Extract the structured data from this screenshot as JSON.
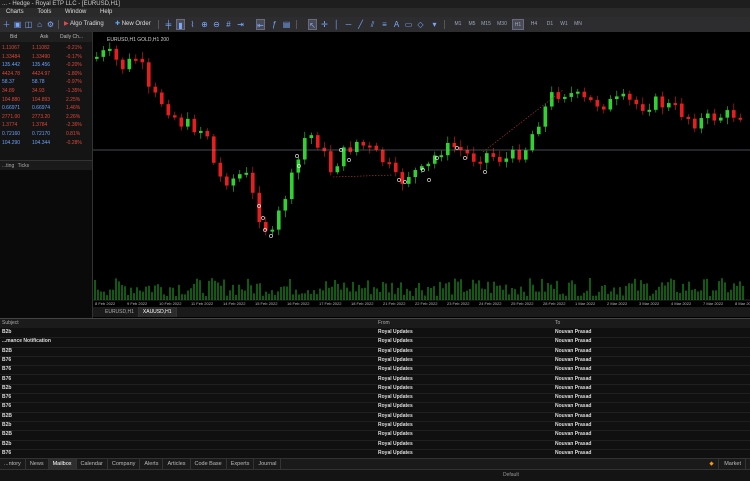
{
  "window": {
    "title": "... - Hedge - Royal ETP LLC - [EURUSD,H1]"
  },
  "menu": [
    "Charts",
    "Tools",
    "Window",
    "Help"
  ],
  "toolbar": {
    "algo_trading": "Algo Trading",
    "new_order": "New Order",
    "timeframes": [
      "M1",
      "M5",
      "M15",
      "M30",
      "H1",
      "H4",
      "D1",
      "W1",
      "MN"
    ],
    "active_timeframe": "H1"
  },
  "market_watch": {
    "headers": [
      "Bid",
      "Ask",
      "Daily Ch..."
    ],
    "rows": [
      {
        "bid": "1.11067",
        "ask": "1.11082",
        "change": "-0.21%",
        "color": "#e0473a"
      },
      {
        "bid": "1.33484",
        "ask": "1.33490",
        "change": "-0.17%",
        "color": "#e0473a"
      },
      {
        "bid": "135.442",
        "ask": "135.456",
        "change": "-0.20%",
        "color": "#6aa2ff"
      },
      {
        "bid": "4424.78",
        "ask": "4424.97",
        "change": "-1.80%",
        "color": "#e0473a"
      },
      {
        "bid": "58.37",
        "ask": "58.78",
        "change": "-0.97%",
        "color": "#6aa2ff"
      },
      {
        "bid": "34.89",
        "ask": "34.93",
        "change": "-1.35%",
        "color": "#e0473a"
      },
      {
        "bid": "104.880",
        "ask": "104.893",
        "change": "2.25%",
        "color": "#e0473a"
      },
      {
        "bid": "0.66971",
        "ask": "0.66974",
        "change": "1.46%",
        "color": "#6aa2ff"
      },
      {
        "bid": "2771.00",
        "ask": "2773.20",
        "change": "2.26%",
        "color": "#e0473a"
      },
      {
        "bid": "1.3774",
        "ask": "1.3784",
        "change": "-2.36%",
        "color": "#e0473a"
      },
      {
        "bid": "0.72160",
        "ask": "0.72170",
        "change": "0.81%",
        "color": "#6aa2ff"
      },
      {
        "bid": "104.290",
        "ask": "104.344",
        "change": "-0.28%",
        "color": "#6aa2ff"
      }
    ],
    "tabs": [
      "...ting",
      "Ticks"
    ]
  },
  "chart": {
    "header": "EURUSD,H1  GOLD,H1  200",
    "time_labels": [
      "8 Feb 2022",
      "9 Feb 2022",
      "10 Feb 2022",
      "11 Feb 2022",
      "14 Feb 2022",
      "15 Feb 2022",
      "16 Feb 2022",
      "17 Feb 2022",
      "18 Feb 2022",
      "21 Feb 2022",
      "22 Feb 2022",
      "23 Feb 2022",
      "24 Feb 2022",
      "25 Feb 2022",
      "28 Feb 2022",
      "1 Mar 2022",
      "2 Mar 2022",
      "3 Mar 2022",
      "4 Mar 2022",
      "7 Mar 2022",
      "8 Mar 2022"
    ],
    "up_color": "#2fd32f",
    "down_color": "#e81e1e",
    "tabs": [
      "EURUSD,H1",
      "XAUUSD,H1"
    ],
    "active_tab": "XAUUSD,H1"
  },
  "terminal": {
    "columns": {
      "subject": "Subject",
      "from": "From",
      "to": "To"
    },
    "rows": [
      {
        "subject": "B2b",
        "from": "Royal Updates",
        "to": "Nouvan Prasad"
      },
      {
        "subject": "...mance Notification",
        "from": "Royal Updates",
        "to": "Nouvan Prasad"
      },
      {
        "subject": "B2B",
        "from": "Royal Updates",
        "to": "Nouvan Prasad"
      },
      {
        "subject": "B76",
        "from": "Royal Updates",
        "to": "Nouvan Prasad"
      },
      {
        "subject": "B76",
        "from": "Royal Updates",
        "to": "Nouvan Prasad"
      },
      {
        "subject": "B76",
        "from": "Royal Updates",
        "to": "Nouvan Prasad"
      },
      {
        "subject": "B2b",
        "from": "Royal Updates",
        "to": "Nouvan Prasad"
      },
      {
        "subject": "B76",
        "from": "Royal Updates",
        "to": "Nouvan Prasad"
      },
      {
        "subject": "B76",
        "from": "Royal Updates",
        "to": "Nouvan Prasad"
      },
      {
        "subject": "B2B",
        "from": "Royal Updates",
        "to": "Nouvan Prasad"
      },
      {
        "subject": "B2b",
        "from": "Royal Updates",
        "to": "Nouvan Prasad"
      },
      {
        "subject": "B2B",
        "from": "Royal Updates",
        "to": "Nouvan Prasad"
      },
      {
        "subject": "B2b",
        "from": "Royal Updates",
        "to": "Nouvan Prasad"
      },
      {
        "subject": "B76",
        "from": "Royal Updates",
        "to": "Nouvan Prasad"
      }
    ],
    "tabs": [
      "...ntory",
      "News",
      "Mailbox",
      "Calendar",
      "Company",
      "Alerts",
      "Articles",
      "Code Base",
      "Experts",
      "Journal"
    ],
    "active_tab": "Mailbox",
    "market_label": "Market"
  },
  "status": {
    "profile": "Default"
  }
}
